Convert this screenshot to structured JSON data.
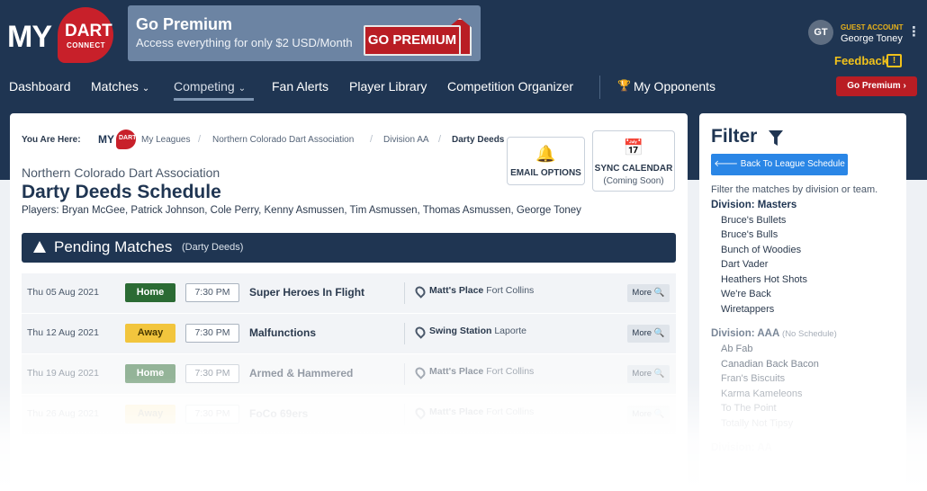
{
  "brand": {
    "logo_my": "MY",
    "logo_dart": "DART",
    "logo_connect": "CONNECT",
    "primary_color": "#1f3552",
    "accent_red": "#b91d24"
  },
  "banner": {
    "title": "Go Premium",
    "subtitle": "Access everything for only $2 USD/Month",
    "button_label": "GO PREMIUM"
  },
  "account": {
    "initials": "GT",
    "label": "GUEST ACCOUNT",
    "name": "George Toney",
    "menu_icon": "⋮",
    "feedback_label": "Feedback",
    "feedback_icon": "!"
  },
  "nav": {
    "dashboard": "Dashboard",
    "matches": "Matches",
    "competing": "Competing",
    "fan_alerts": "Fan Alerts",
    "player_library": "Player Library",
    "competition_organizer": "Competition Organizer",
    "my_opponents": "My Opponents",
    "go_premium": "Go Premium ›",
    "chevron": "⌄"
  },
  "breadcrumb": {
    "here": "You Are Here:",
    "logo_my": "MY",
    "logo_dart": "DART",
    "items": [
      "My Leagues",
      "Northern Colorado Dart Association",
      "Division AA",
      "Darty Deeds"
    ],
    "separator": "/"
  },
  "actions": {
    "email_icon": "🔔",
    "email_label": "EMAIL OPTIONS",
    "sync_icon": "📅",
    "sync_label": "SYNC CALENDAR",
    "sync_sub": "(Coming Soon)"
  },
  "page": {
    "league": "Northern Colorado Dart Association",
    "title": "Darty Deeds Schedule",
    "players": "Players: Bryan McGee, Patrick Johnson, Cole Perry, Kenny Asmussen, Tim Asmussen, Thomas Asmussen, George Toney"
  },
  "pending": {
    "title": "Pending Matches",
    "team": "(Darty Deeds)"
  },
  "matches": [
    {
      "date": "Thu 05 Aug 2021",
      "loc": "Home",
      "time": "7:30 PM",
      "opponent": "Super Heroes In Flight",
      "venue": "Matt's Place",
      "city": "Fort Collins",
      "more": "More"
    },
    {
      "date": "Thu 12 Aug 2021",
      "loc": "Away",
      "time": "7:30 PM",
      "opponent": "Malfunctions",
      "venue": "Swing Station",
      "city": "Laporte",
      "more": "More"
    },
    {
      "date": "Thu 19 Aug 2021",
      "loc": "Home",
      "time": "7:30 PM",
      "opponent": "Armed & Hammered",
      "venue": "Matt's Place",
      "city": "Fort Collins",
      "more": "More"
    },
    {
      "date": "Thu 26 Aug 2021",
      "loc": "Away",
      "time": "7:30 PM",
      "opponent": "FoCo 69ers",
      "venue": "Matt's Place",
      "city": "Fort Collins",
      "more": "More"
    }
  ],
  "filter": {
    "title": "Filter",
    "back_label": "🡐  Back To League Schedule",
    "description": "Filter the matches by division or team.",
    "divisions": [
      {
        "title": "Division: Masters",
        "note": "",
        "teams": [
          "Bruce's Bullets",
          "Bruce's Bulls",
          "Bunch of Woodies",
          "Dart Vader",
          "Heathers Hot Shots",
          "We're Back",
          "Wiretappers"
        ]
      },
      {
        "title": "Division: AAA",
        "note": "(No Schedule)",
        "teams": [
          "Ab Fab",
          "Canadian Back Bacon",
          "Fran's Biscuits",
          "Karma Kameleons",
          "To The Point",
          "Totally Not Tipsy"
        ]
      },
      {
        "title": "Division: AA",
        "note": "",
        "teams": []
      }
    ]
  }
}
